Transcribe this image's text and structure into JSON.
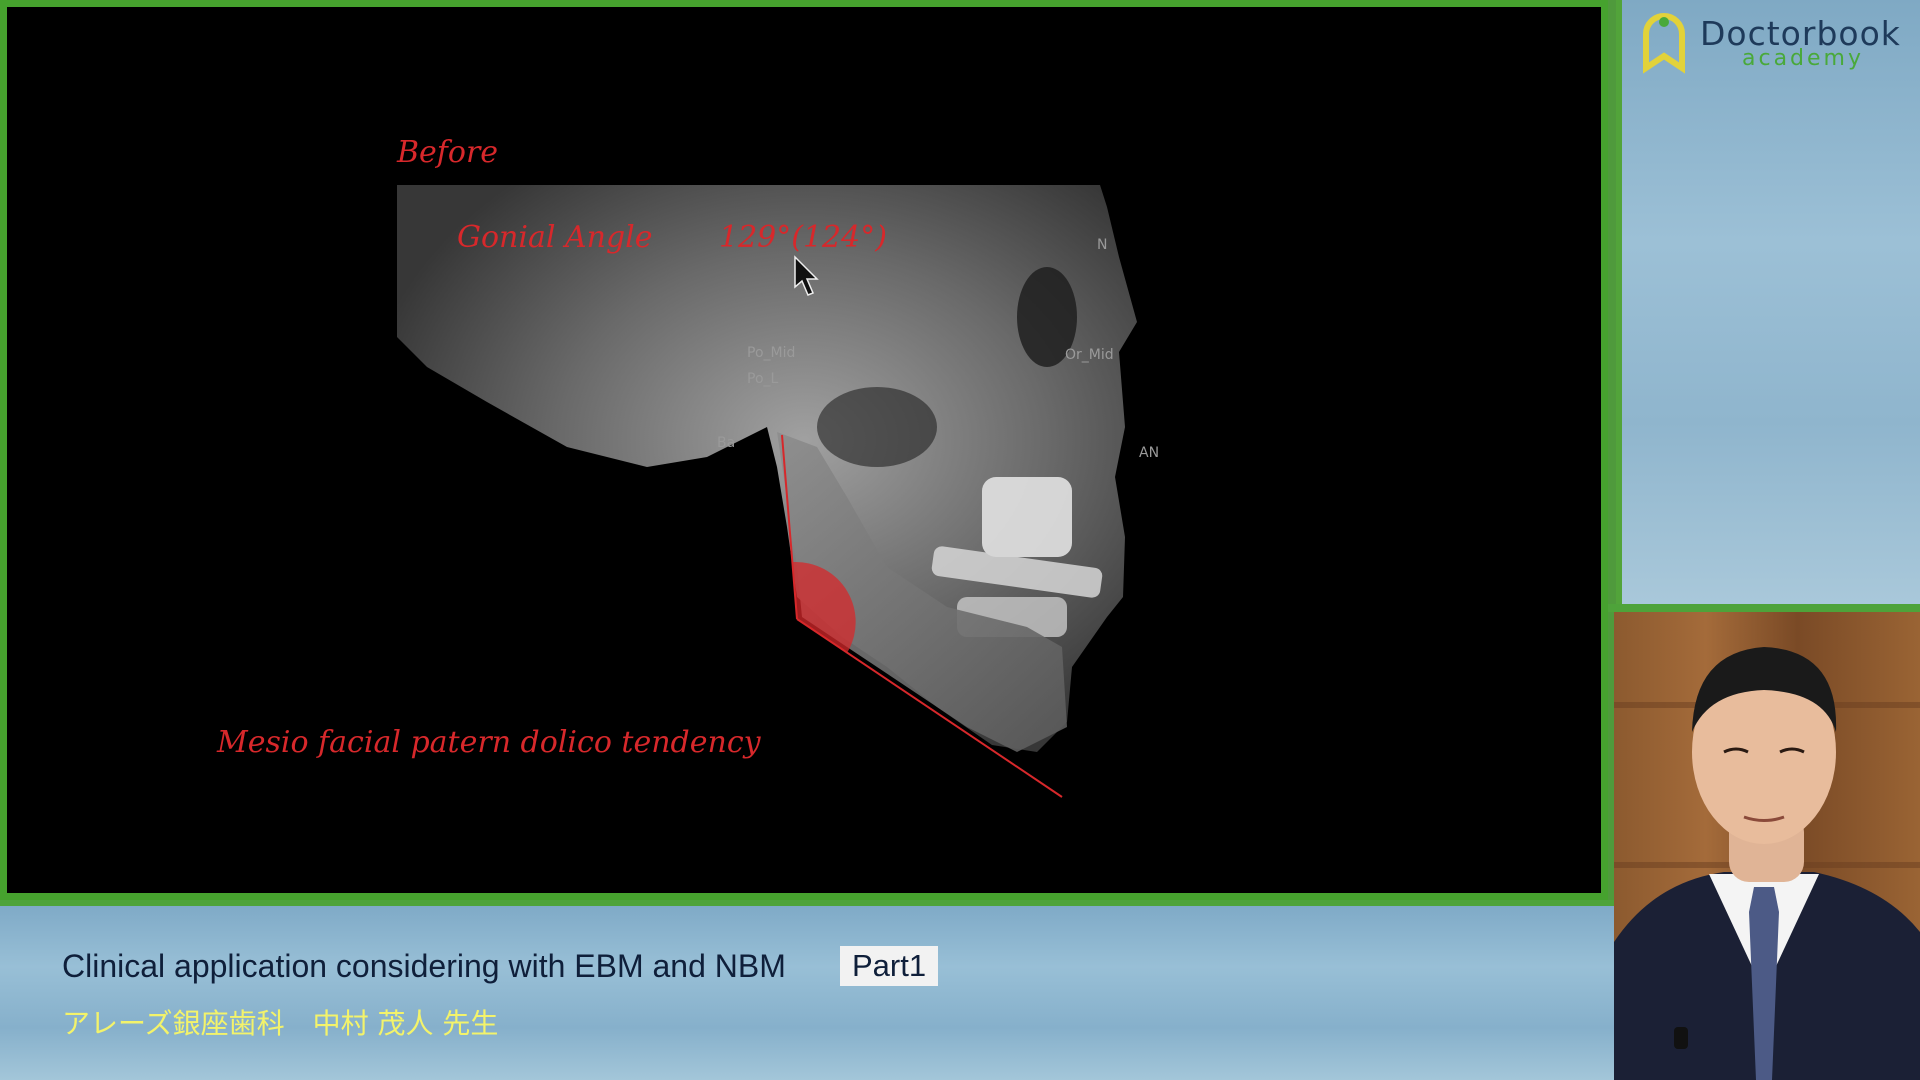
{
  "slide": {
    "before_label": "Before",
    "angle_label": "Gonial Angle",
    "angle_value": "129°(124°)",
    "pattern_note": "Mesio facial patern dolico tendency",
    "landmarks": {
      "po_mid": "Po_Mid",
      "po_l": "Po_L",
      "ba": "Ba",
      "or_mid": "Or_Mid",
      "n": "N",
      "an": "AN"
    },
    "accent_color": "#d7282b"
  },
  "logo": {
    "name": "Doctorbook",
    "sub": "academy",
    "brand_color": "#1e3a5a",
    "accent_color": "#49a93a"
  },
  "caption": {
    "title": "Clinical application considering with EBM and NBM",
    "part": "Part1",
    "subtitle": "アレーズ銀座歯科　中村 茂人 先生"
  }
}
